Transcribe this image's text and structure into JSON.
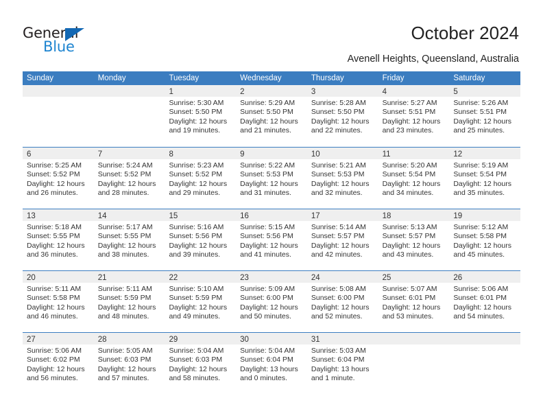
{
  "brand": {
    "word_top": "General",
    "word_bottom": "Blue",
    "triangle_icon": "triangle-icon",
    "color_dark": "#231f20",
    "color_blue": "#1d84d0"
  },
  "header": {
    "title": "October 2024",
    "subtitle": "Avenell Heights, Queensland, Australia"
  },
  "theme": {
    "header_band": "#3b7dc0",
    "daynum_band": "#efefef",
    "row_divider": "#3b7dc0",
    "text": "#333333"
  },
  "weekdays": [
    "Sunday",
    "Monday",
    "Tuesday",
    "Wednesday",
    "Thursday",
    "Friday",
    "Saturday"
  ],
  "weeks": [
    [
      {
        "day": "",
        "lines": []
      },
      {
        "day": "",
        "lines": []
      },
      {
        "day": "1",
        "lines": [
          "Sunrise: 5:30 AM",
          "Sunset: 5:50 PM",
          "Daylight: 12 hours",
          "and 19 minutes."
        ]
      },
      {
        "day": "2",
        "lines": [
          "Sunrise: 5:29 AM",
          "Sunset: 5:50 PM",
          "Daylight: 12 hours",
          "and 21 minutes."
        ]
      },
      {
        "day": "3",
        "lines": [
          "Sunrise: 5:28 AM",
          "Sunset: 5:50 PM",
          "Daylight: 12 hours",
          "and 22 minutes."
        ]
      },
      {
        "day": "4",
        "lines": [
          "Sunrise: 5:27 AM",
          "Sunset: 5:51 PM",
          "Daylight: 12 hours",
          "and 23 minutes."
        ]
      },
      {
        "day": "5",
        "lines": [
          "Sunrise: 5:26 AM",
          "Sunset: 5:51 PM",
          "Daylight: 12 hours",
          "and 25 minutes."
        ]
      }
    ],
    [
      {
        "day": "6",
        "lines": [
          "Sunrise: 5:25 AM",
          "Sunset: 5:52 PM",
          "Daylight: 12 hours",
          "and 26 minutes."
        ]
      },
      {
        "day": "7",
        "lines": [
          "Sunrise: 5:24 AM",
          "Sunset: 5:52 PM",
          "Daylight: 12 hours",
          "and 28 minutes."
        ]
      },
      {
        "day": "8",
        "lines": [
          "Sunrise: 5:23 AM",
          "Sunset: 5:52 PM",
          "Daylight: 12 hours",
          "and 29 minutes."
        ]
      },
      {
        "day": "9",
        "lines": [
          "Sunrise: 5:22 AM",
          "Sunset: 5:53 PM",
          "Daylight: 12 hours",
          "and 31 minutes."
        ]
      },
      {
        "day": "10",
        "lines": [
          "Sunrise: 5:21 AM",
          "Sunset: 5:53 PM",
          "Daylight: 12 hours",
          "and 32 minutes."
        ]
      },
      {
        "day": "11",
        "lines": [
          "Sunrise: 5:20 AM",
          "Sunset: 5:54 PM",
          "Daylight: 12 hours",
          "and 34 minutes."
        ]
      },
      {
        "day": "12",
        "lines": [
          "Sunrise: 5:19 AM",
          "Sunset: 5:54 PM",
          "Daylight: 12 hours",
          "and 35 minutes."
        ]
      }
    ],
    [
      {
        "day": "13",
        "lines": [
          "Sunrise: 5:18 AM",
          "Sunset: 5:55 PM",
          "Daylight: 12 hours",
          "and 36 minutes."
        ]
      },
      {
        "day": "14",
        "lines": [
          "Sunrise: 5:17 AM",
          "Sunset: 5:55 PM",
          "Daylight: 12 hours",
          "and 38 minutes."
        ]
      },
      {
        "day": "15",
        "lines": [
          "Sunrise: 5:16 AM",
          "Sunset: 5:56 PM",
          "Daylight: 12 hours",
          "and 39 minutes."
        ]
      },
      {
        "day": "16",
        "lines": [
          "Sunrise: 5:15 AM",
          "Sunset: 5:56 PM",
          "Daylight: 12 hours",
          "and 41 minutes."
        ]
      },
      {
        "day": "17",
        "lines": [
          "Sunrise: 5:14 AM",
          "Sunset: 5:57 PM",
          "Daylight: 12 hours",
          "and 42 minutes."
        ]
      },
      {
        "day": "18",
        "lines": [
          "Sunrise: 5:13 AM",
          "Sunset: 5:57 PM",
          "Daylight: 12 hours",
          "and 43 minutes."
        ]
      },
      {
        "day": "19",
        "lines": [
          "Sunrise: 5:12 AM",
          "Sunset: 5:58 PM",
          "Daylight: 12 hours",
          "and 45 minutes."
        ]
      }
    ],
    [
      {
        "day": "20",
        "lines": [
          "Sunrise: 5:11 AM",
          "Sunset: 5:58 PM",
          "Daylight: 12 hours",
          "and 46 minutes."
        ]
      },
      {
        "day": "21",
        "lines": [
          "Sunrise: 5:11 AM",
          "Sunset: 5:59 PM",
          "Daylight: 12 hours",
          "and 48 minutes."
        ]
      },
      {
        "day": "22",
        "lines": [
          "Sunrise: 5:10 AM",
          "Sunset: 5:59 PM",
          "Daylight: 12 hours",
          "and 49 minutes."
        ]
      },
      {
        "day": "23",
        "lines": [
          "Sunrise: 5:09 AM",
          "Sunset: 6:00 PM",
          "Daylight: 12 hours",
          "and 50 minutes."
        ]
      },
      {
        "day": "24",
        "lines": [
          "Sunrise: 5:08 AM",
          "Sunset: 6:00 PM",
          "Daylight: 12 hours",
          "and 52 minutes."
        ]
      },
      {
        "day": "25",
        "lines": [
          "Sunrise: 5:07 AM",
          "Sunset: 6:01 PM",
          "Daylight: 12 hours",
          "and 53 minutes."
        ]
      },
      {
        "day": "26",
        "lines": [
          "Sunrise: 5:06 AM",
          "Sunset: 6:01 PM",
          "Daylight: 12 hours",
          "and 54 minutes."
        ]
      }
    ],
    [
      {
        "day": "27",
        "lines": [
          "Sunrise: 5:06 AM",
          "Sunset: 6:02 PM",
          "Daylight: 12 hours",
          "and 56 minutes."
        ]
      },
      {
        "day": "28",
        "lines": [
          "Sunrise: 5:05 AM",
          "Sunset: 6:03 PM",
          "Daylight: 12 hours",
          "and 57 minutes."
        ]
      },
      {
        "day": "29",
        "lines": [
          "Sunrise: 5:04 AM",
          "Sunset: 6:03 PM",
          "Daylight: 12 hours",
          "and 58 minutes."
        ]
      },
      {
        "day": "30",
        "lines": [
          "Sunrise: 5:04 AM",
          "Sunset: 6:04 PM",
          "Daylight: 13 hours",
          "and 0 minutes."
        ]
      },
      {
        "day": "31",
        "lines": [
          "Sunrise: 5:03 AM",
          "Sunset: 6:04 PM",
          "Daylight: 13 hours",
          "and 1 minute."
        ]
      },
      {
        "day": "",
        "lines": []
      },
      {
        "day": "",
        "lines": []
      }
    ]
  ]
}
